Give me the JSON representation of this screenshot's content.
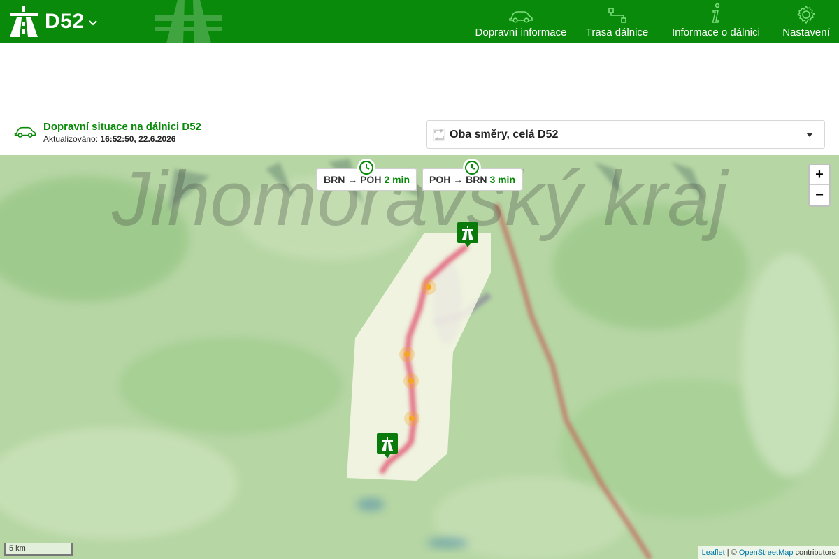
{
  "header": {
    "highway": "D52",
    "nav": [
      {
        "label": "Dopravní informace",
        "icon": "car-icon"
      },
      {
        "label": "Trasa dálnice",
        "icon": "route-icon"
      },
      {
        "label": "Informace o dálnici",
        "icon": "info-icon"
      },
      {
        "label": "Nastavení",
        "icon": "gear-icon"
      }
    ]
  },
  "status": {
    "title": "Dopravní situace na dálnici D52",
    "updated_label": "Aktualizováno:",
    "updated_value": "16:52:50, 22.6.2026"
  },
  "direction_select": {
    "value": "Oba směry, celá D52"
  },
  "travel_times": [
    {
      "route": "BRN → POH",
      "minutes": "2 min"
    },
    {
      "route": "POH → BRN",
      "minutes": "3 min"
    }
  ],
  "map": {
    "region_label": "Jihomoravský kraj",
    "zoom_in": "+",
    "zoom_out": "−",
    "scale": "5 km",
    "attribution": {
      "leaflet": "Leaflet",
      "separator": " | © ",
      "osm": "OpenStreetMap",
      "suffix": " contributors"
    }
  },
  "colors": {
    "brand_green": "#0a8a0a",
    "route_red": "#e0506e",
    "incident_orange": "#f5a623"
  }
}
